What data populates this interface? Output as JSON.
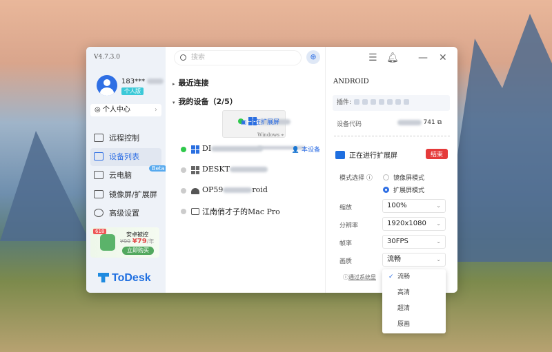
{
  "app": {
    "version": "V4.7.3.0",
    "brand": "ToDesk"
  },
  "user": {
    "name_prefix": "183***",
    "plan": "个人版",
    "center": "个人中心"
  },
  "nav": [
    {
      "label": "远程控制"
    },
    {
      "label": "设备列表",
      "active": true
    },
    {
      "label": "云电脑",
      "badge": "Beta"
    },
    {
      "label": "镜像屏/扩展屏"
    },
    {
      "label": "高级设置"
    }
  ],
  "promo": {
    "tag": "618",
    "title": "安卓被控",
    "old_price": "¥99",
    "price": "¥79",
    "unit": "/年",
    "button": "立即购买"
  },
  "search": {
    "placeholder": "搜索"
  },
  "sections": {
    "recent": "最近连接",
    "mine": "我的设备（2/5）"
  },
  "devices": [
    {
      "name": "",
      "os": "Windows",
      "status": "正在扩展屏",
      "online": true
    },
    {
      "name": "DI",
      "status": "本设备",
      "online": true
    },
    {
      "name": "DESKT",
      "online": false
    },
    {
      "name": "OP59",
      "name_suffix": "roid",
      "online": false
    },
    {
      "name": "江南俏才子的Mac Pro",
      "online": false
    }
  ],
  "panel": {
    "title": "ANDROID",
    "plugins_label": "插件:",
    "code_label": "设备代码",
    "code_suffix": "741",
    "extending": "正在进行扩展屏",
    "end": "结束",
    "mode_label": "模式选择",
    "modes": [
      "镜像屏模式",
      "扩展屏模式"
    ],
    "selected_mode": 1,
    "settings": [
      {
        "label": "缩放",
        "value": "100%"
      },
      {
        "label": "分辨率",
        "value": "1920x1080"
      },
      {
        "label": "帧率",
        "value": "30FPS"
      },
      {
        "label": "画质",
        "value": "流畅"
      }
    ],
    "note": "通过系统显"
  },
  "quality_options": [
    "流畅",
    "高清",
    "超清",
    "原画"
  ],
  "selected_quality": "流畅"
}
